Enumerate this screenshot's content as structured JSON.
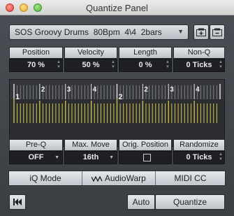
{
  "window": {
    "title": "Quantize Panel"
  },
  "preset": {
    "name": "SOS Groovy Drums  80Bpm  4\\4  2bars"
  },
  "params_top": [
    {
      "label": "Position",
      "value": "70 %"
    },
    {
      "label": "Velocity",
      "value": "50 %"
    },
    {
      "label": "Length",
      "value": "0 %"
    },
    {
      "label": "Non-Q",
      "value": "0 Ticks"
    }
  ],
  "grid": {
    "bar_labels": [
      "1",
      "2"
    ],
    "beat_labels": [
      "2",
      "3",
      "4",
      "2",
      "3",
      "4"
    ]
  },
  "params_bottom": [
    {
      "label": "Pre-Q",
      "value": "OFF"
    },
    {
      "label": "Max. Move",
      "value": "16th"
    },
    {
      "label": "Orig. Position",
      "checked": false
    },
    {
      "label": "Randomize",
      "value": "0 Ticks"
    }
  ],
  "tabs": {
    "iq_prefix": "iQ",
    "mode": "Mode",
    "audiowarp": "AudioWarp",
    "midicc": "MIDI CC"
  },
  "buttons": {
    "auto": "Auto",
    "quantize": "Quantize"
  }
}
